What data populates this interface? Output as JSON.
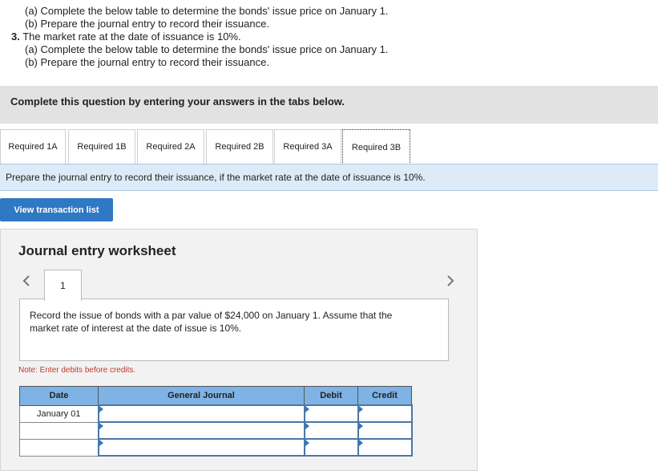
{
  "question": {
    "line1": "(a) Complete the below table to determine the bonds' issue price on January 1.",
    "line2": "(b) Prepare the journal entry to record their issuance.",
    "item3_num": "3.",
    "item3_text": "The market rate at the date of issuance is 10%.",
    "line3": "(a) Complete the below table to determine the bonds' issue price on January 1.",
    "line4": "(b) Prepare the journal entry to record their issuance."
  },
  "banner": "Complete this question by entering your answers in the tabs below.",
  "tabs": [
    {
      "label": "Required 1A"
    },
    {
      "label": "Required 1B"
    },
    {
      "label": "Required 2A"
    },
    {
      "label": "Required 2B"
    },
    {
      "label": "Required 3A"
    },
    {
      "label": "Required 3B"
    }
  ],
  "active_tab": "Required 3B",
  "instruction": "Prepare the journal entry to record their issuance, if the market rate at the date of issuance is 10%.",
  "view_transaction_list": "View transaction list",
  "worksheet": {
    "title": "Journal entry worksheet",
    "page": "1",
    "record_text": "Record the issue of bonds with a par value of $24,000 on January 1. Assume that the market rate of interest at the date of issue is 10%.",
    "note": "Note: Enter debits before credits.",
    "columns": [
      "Date",
      "General Journal",
      "Debit",
      "Credit"
    ],
    "rows": [
      {
        "date": "January 01"
      },
      {
        "date": ""
      },
      {
        "date": ""
      }
    ]
  },
  "colors": {
    "accent": "#2f78c4",
    "header_blue": "#7fb2e5",
    "instruction_bg": "#dcebf7",
    "note_red": "#c0392b"
  }
}
